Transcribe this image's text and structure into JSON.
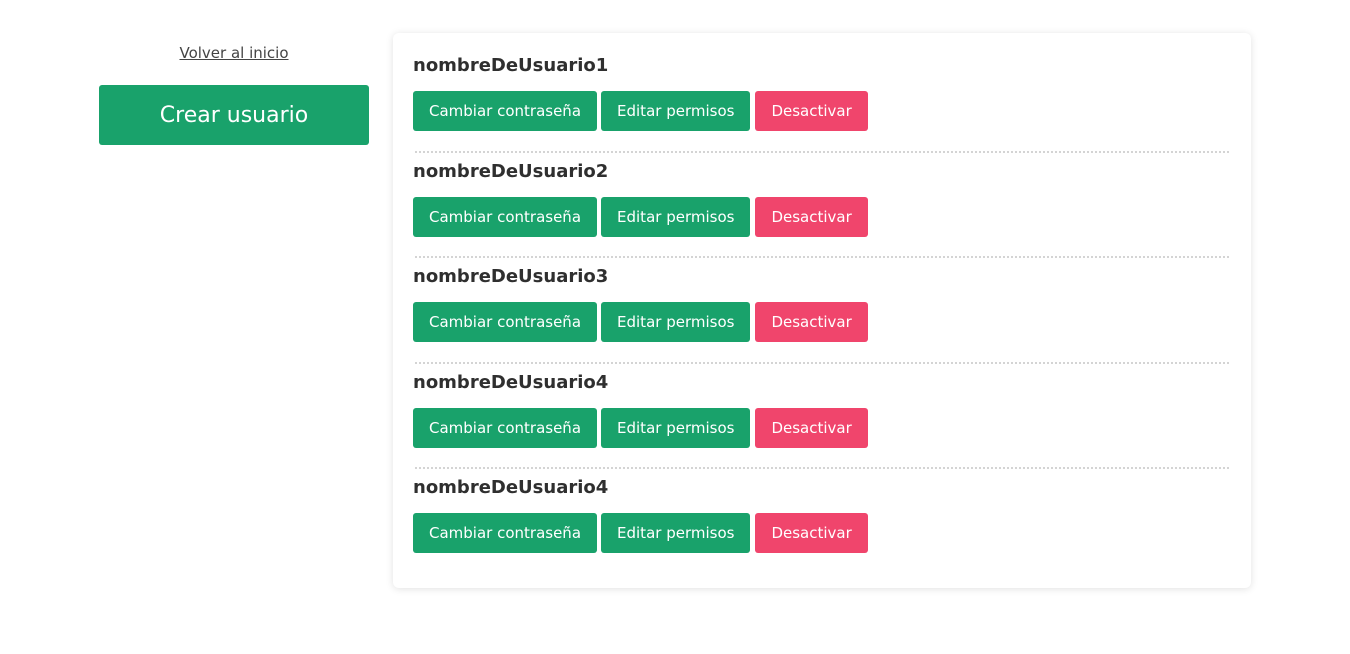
{
  "colors": {
    "primary": "#19a26b",
    "danger": "#f0456c"
  },
  "sidebar": {
    "back_link": "Volver al inicio",
    "create_button": "Crear usuario"
  },
  "users": [
    {
      "name": "nombreDeUsuario1"
    },
    {
      "name": "nombreDeUsuario2"
    },
    {
      "name": "nombreDeUsuario3"
    },
    {
      "name": "nombreDeUsuario4"
    },
    {
      "name": "nombreDeUsuario4"
    }
  ],
  "actions": {
    "change_password": "Cambiar contraseña",
    "edit_permissions": "Editar permisos",
    "deactivate": "Desactivar"
  }
}
